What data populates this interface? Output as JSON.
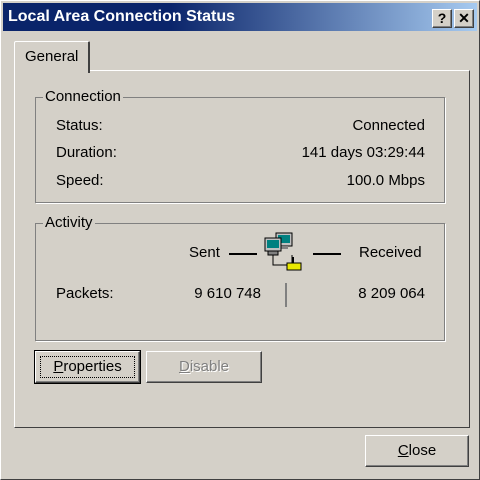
{
  "window": {
    "title": "Local Area Connection Status"
  },
  "titlebar_buttons": {
    "help": "?",
    "close": "✕"
  },
  "tabs": [
    {
      "label": "General"
    }
  ],
  "connection": {
    "group_label": "Connection",
    "rows": [
      {
        "label": "Status:",
        "value": "Connected"
      },
      {
        "label": "Duration:",
        "value": "141 days 03:29:44"
      },
      {
        "label": "Speed:",
        "value": "100.0 Mbps"
      }
    ]
  },
  "activity": {
    "group_label": "Activity",
    "sent_label": "Sent",
    "received_label": "Received",
    "packets_label": "Packets:",
    "packets_sent": "9 610 748",
    "packets_received": "8 209 064",
    "icon": "network-computers-icon"
  },
  "buttons": {
    "properties": {
      "accel": "P",
      "rest": "roperties"
    },
    "disable": {
      "accel": "D",
      "rest": "isable"
    },
    "close": {
      "accel": "C",
      "rest": "lose"
    }
  },
  "colors": {
    "titlebar_start": "#0a246a",
    "titlebar_end": "#a6caf0",
    "face": "#d4d0c8"
  }
}
